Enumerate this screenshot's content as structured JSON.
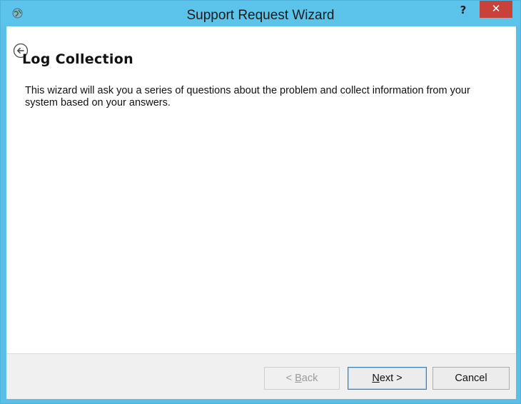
{
  "window": {
    "title": "Support Request Wizard",
    "help_label": "?",
    "close_label": "✕",
    "accent_color": "#5cc4ea",
    "close_color": "#c8413a"
  },
  "page": {
    "title": "Log Collection",
    "description": "This wizard will ask you a series of questions about the problem and collect information from your system based on your answers."
  },
  "buttons": {
    "back": {
      "prefix": "< ",
      "mnemonic": "B",
      "rest": "ack",
      "enabled": false
    },
    "next": {
      "mnemonic": "N",
      "rest": "ext >",
      "enabled": true
    },
    "cancel": {
      "label": "Cancel",
      "enabled": true
    }
  },
  "icons": {
    "app": "globe-icon",
    "back_nav": "back-arrow-icon"
  }
}
